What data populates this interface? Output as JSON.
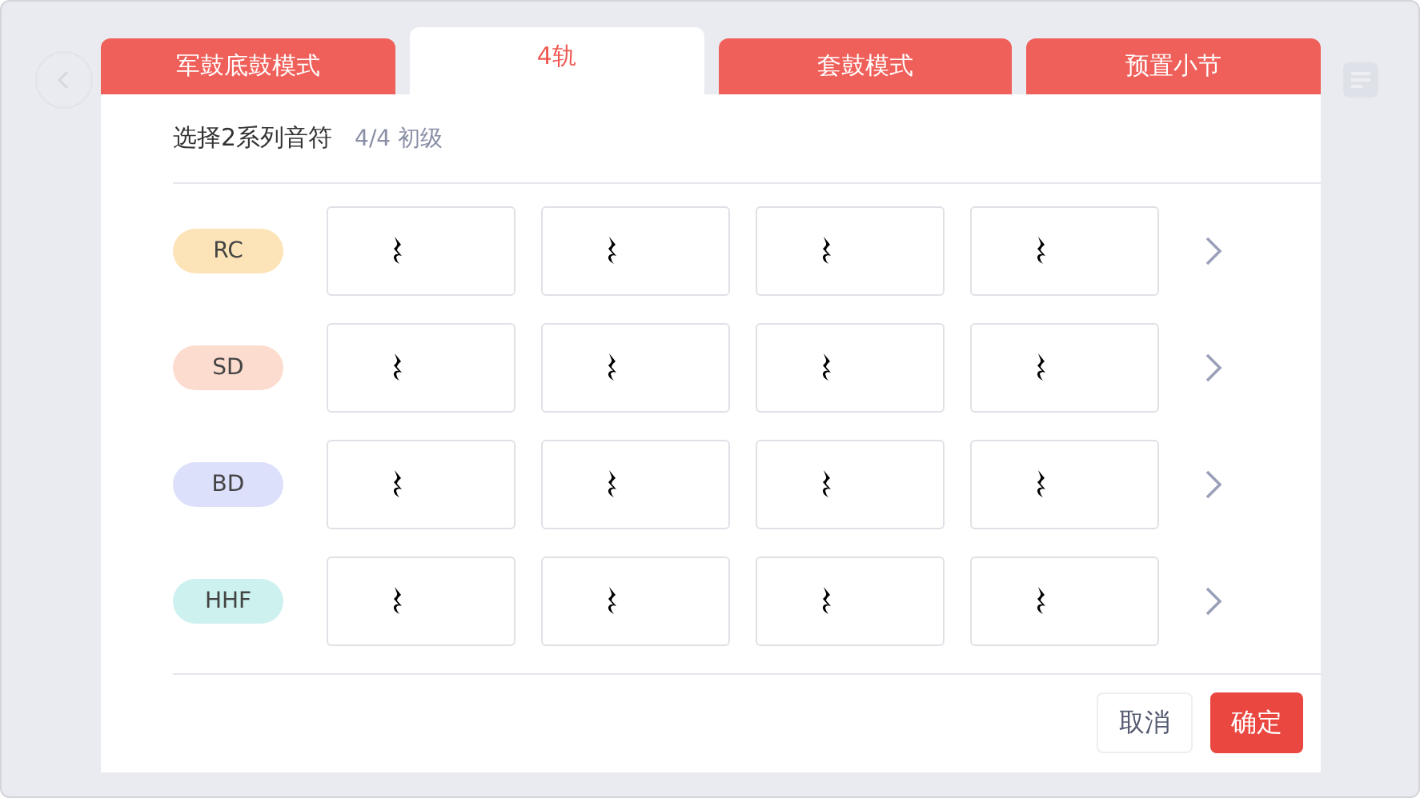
{
  "tabs": [
    {
      "label": "军鼓底鼓模式",
      "selected": false
    },
    {
      "label": "4轨",
      "selected": true
    },
    {
      "label": "套鼓模式",
      "selected": false
    },
    {
      "label": "预置小节",
      "selected": false
    }
  ],
  "header": {
    "title": "选择2系列音符",
    "subtitle": "4/4 初级"
  },
  "tracks": [
    {
      "name": "RC",
      "color": "#fde4b8",
      "cells": [
        {
          "kind": "rest"
        },
        {
          "kind": "rest"
        },
        {
          "kind": "rest"
        },
        {
          "kind": "rest"
        }
      ]
    },
    {
      "name": "SD",
      "color": "#fcdccf",
      "cells": [
        {
          "kind": "rest"
        },
        {
          "kind": "rest"
        },
        {
          "kind": "rest"
        },
        {
          "kind": "rest"
        }
      ]
    },
    {
      "name": "BD",
      "color": "#dde0fb",
      "cells": [
        {
          "kind": "rest"
        },
        {
          "kind": "rest"
        },
        {
          "kind": "rest"
        },
        {
          "kind": "rest"
        }
      ]
    },
    {
      "name": "HHF",
      "color": "#ccf1ef",
      "cells": [
        {
          "kind": "rest"
        },
        {
          "kind": "rest"
        },
        {
          "kind": "rest"
        },
        {
          "kind": "rest"
        }
      ]
    }
  ],
  "buttons": {
    "cancel": "取消",
    "confirm": "确定"
  }
}
